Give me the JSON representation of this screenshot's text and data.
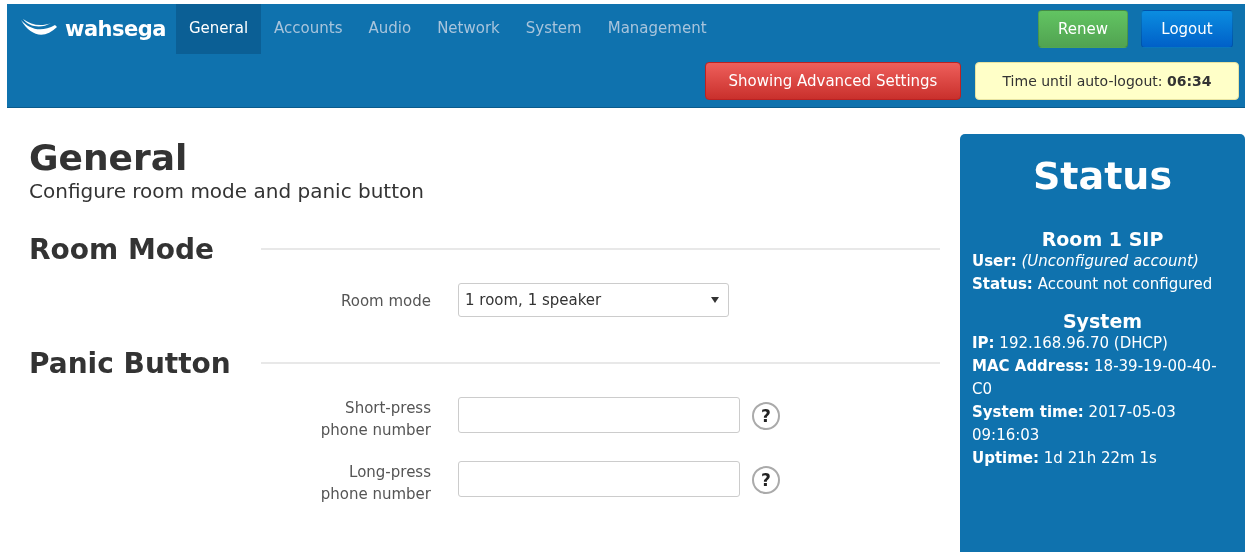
{
  "header": {
    "logo_text": "wahsega",
    "nav": [
      {
        "label": "General",
        "selected": true
      },
      {
        "label": "Accounts",
        "selected": false
      },
      {
        "label": "Audio",
        "selected": false
      },
      {
        "label": "Network",
        "selected": false
      },
      {
        "label": "System",
        "selected": false
      },
      {
        "label": "Management",
        "selected": false
      }
    ],
    "buttons": [
      {
        "label": "Renew",
        "kind": "renew"
      },
      {
        "label": "Logout",
        "kind": "logout"
      }
    ],
    "advanced_button": "Showing Advanced Settings",
    "auto_logout": "Time until auto-logout: **06:34**"
  },
  "page": {
    "title": "General",
    "subtitle": "Configure room mode and panic button",
    "sections": [
      {
        "title": "Room Mode",
        "fields": [
          {
            "kind": "select",
            "label": "Room mode",
            "value": "1 room, 1 speaker"
          }
        ]
      },
      {
        "title": "Panic Button",
        "fields": [
          {
            "kind": "text",
            "label": "Short-press phone number",
            "help": "?"
          },
          {
            "kind": "text",
            "label": "Long-press phone number",
            "help": "?"
          }
        ]
      }
    ]
  },
  "status": {
    "title": "Status",
    "groups": [
      {
        "title": "Room 1 SIP",
        "lines": [
          "**User:** *(Unconfigured account)*",
          "**Status:** Account not configured"
        ]
      },
      {
        "title": "System",
        "lines": [
          "**IP:** 192.168.96.70 (DHCP)",
          "**MAC Address:** 18-39-19-00-40-C0",
          "**System time:** 2017-05-03 09:16:03",
          "**Uptime:** 1d 21h 22m 1s"
        ]
      }
    ]
  }
}
